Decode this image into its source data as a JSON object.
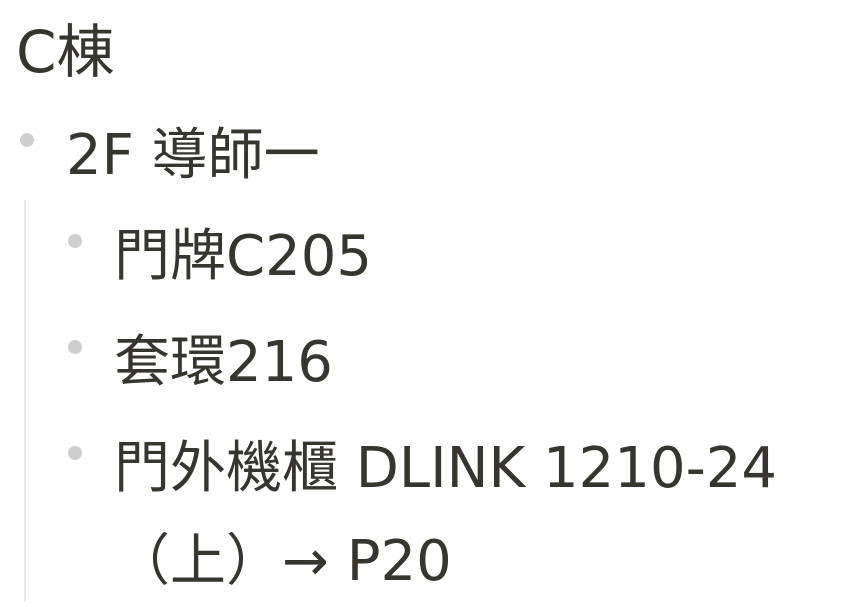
{
  "heading": "C棟",
  "tree": {
    "parent": {
      "label": "2F 導師一",
      "children": [
        {
          "label": "門牌C205"
        },
        {
          "label": "套環216"
        },
        {
          "label_line1": "門外機櫃 DLINK 1210-24",
          "label_line2": "（上）→ P20"
        }
      ]
    }
  }
}
